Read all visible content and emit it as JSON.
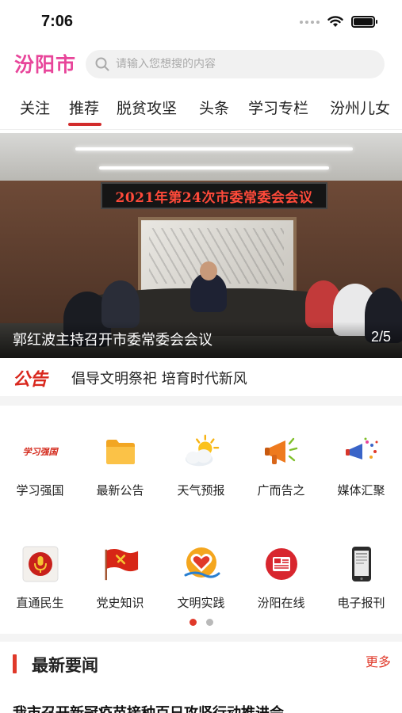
{
  "status_bar": {
    "time": "7:06"
  },
  "header": {
    "brand": "汾阳市",
    "search_placeholder": "请输入您想搜的内容"
  },
  "tabs": [
    {
      "label": "关注"
    },
    {
      "label": "推荐",
      "active": true
    },
    {
      "label": "脱贫攻坚"
    },
    {
      "label": "头条"
    },
    {
      "label": "学习专栏"
    },
    {
      "label": "汾州儿女"
    }
  ],
  "banner": {
    "screen_text": "2021年第24次市委常委会会议",
    "caption": "郭红波主持召开市委常委会会议",
    "counter": "2/5"
  },
  "notice": {
    "label": "公告",
    "text": "倡导文明祭祀 培育时代新风"
  },
  "grid": {
    "items": [
      {
        "label": "学习强国",
        "icon": "xuexi-qiangguo-icon"
      },
      {
        "label": "最新公告",
        "icon": "folder-icon"
      },
      {
        "label": "天气预报",
        "icon": "sun-cloud-icon"
      },
      {
        "label": "广而告之",
        "icon": "megaphone-icon"
      },
      {
        "label": "媒体汇聚",
        "icon": "media-megaphone-icon"
      },
      {
        "label": "直通民生",
        "icon": "microphone-icon"
      },
      {
        "label": "党史知识",
        "icon": "party-flag-icon"
      },
      {
        "label": "文明实践",
        "icon": "heart-badge-icon"
      },
      {
        "label": "汾阳在线",
        "icon": "news-badge-icon"
      },
      {
        "label": "电子报刊",
        "icon": "phone-reader-icon"
      }
    ],
    "xuexi_logo_text": "学习强国",
    "pager": {
      "pages": 2,
      "current": 1
    }
  },
  "section": {
    "title": "最新要闻",
    "more": "更多"
  },
  "news": [
    {
      "title": "我市召开新冠疫苗接种百日攻坚行动推进会"
    }
  ],
  "colors": {
    "brand": "#e8459a",
    "accent": "#e0392a",
    "tab_underline": "#d22c2c"
  }
}
